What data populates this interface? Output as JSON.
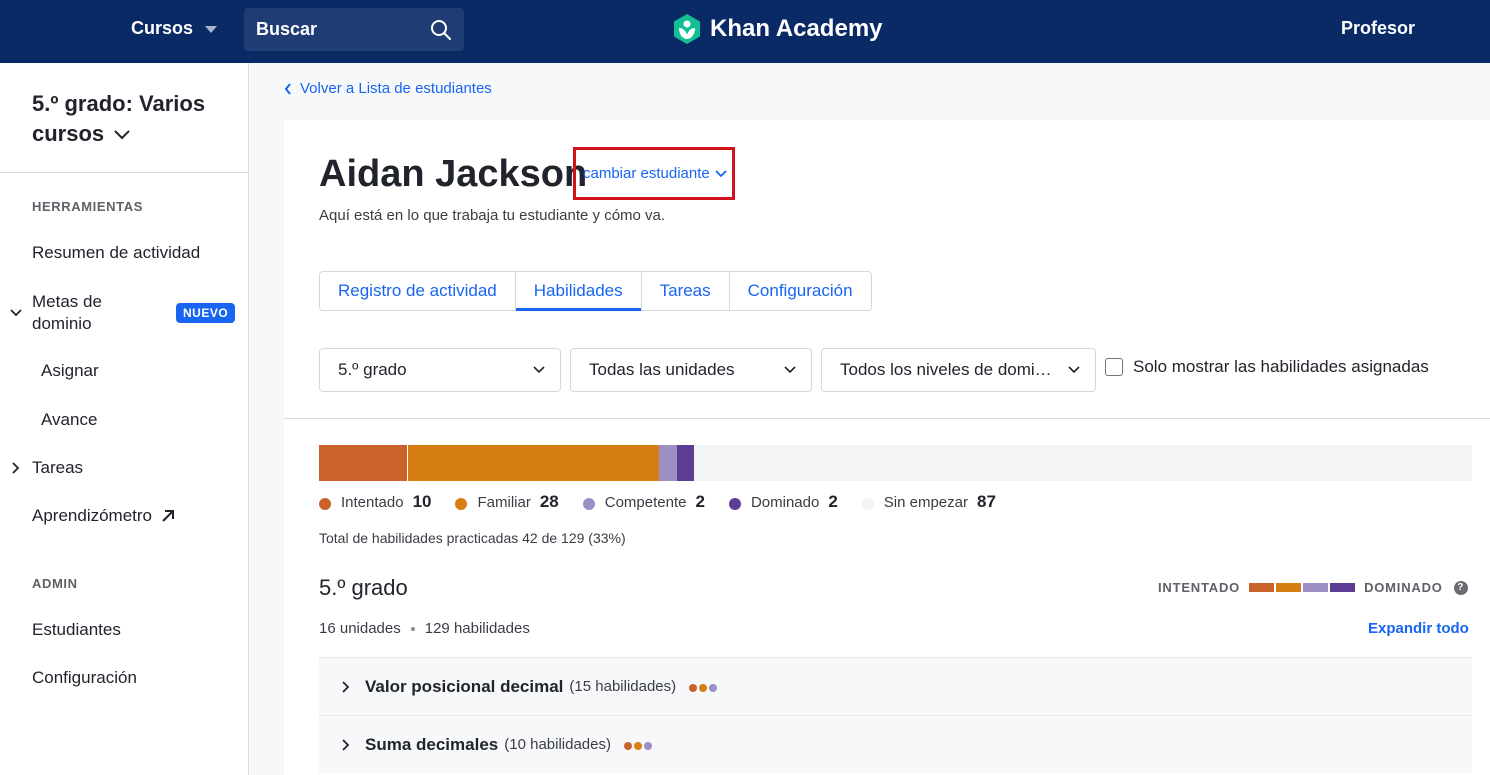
{
  "topbar": {
    "courses_label": "Cursos",
    "search_label": "Buscar",
    "brand": "Khan Academy",
    "role": "Profesor"
  },
  "sidebar": {
    "class_title": "5.º grado: Varios cursos",
    "tools_label": "HERRAMIENTAS",
    "items": {
      "activity": "Resumen de actividad",
      "mastery_goals": "Metas de dominio",
      "new_badge": "NUEVO",
      "assign": "Asignar",
      "progress": "Avance",
      "tasks": "Tareas",
      "learnometer": "Aprendizómetro"
    },
    "admin_label": "ADMIN",
    "admin_items": {
      "students": "Estudiantes",
      "settings": "Configuración"
    }
  },
  "back_link": "Volver a Lista de estudiantes",
  "student": {
    "name": "Aidan Jackson",
    "change_label": "cambiar estudiante",
    "subtitle": "Aquí está en lo que trabaja tu estudiante y cómo va."
  },
  "tabs": [
    {
      "label": "Registro de actividad",
      "active": false
    },
    {
      "label": "Habilidades",
      "active": true
    },
    {
      "label": "Tareas",
      "active": false
    },
    {
      "label": "Configuración",
      "active": false
    }
  ],
  "filters": {
    "grade": "5.º grado",
    "units": "Todas las unidades",
    "levels": "Todos los niveles de domi…",
    "only_assigned": "Solo mostrar las habilidades asignadas",
    "only_assigned_checked": false
  },
  "mastery": {
    "total_skills": 129,
    "levels": [
      {
        "label": "Intentado",
        "count": 10,
        "color": "#c9622b"
      },
      {
        "label": "Familiar",
        "count": 28,
        "color": "#d67d13"
      },
      {
        "label": "Competente",
        "count": 2,
        "color": "#9d8ec4"
      },
      {
        "label": "Dominado",
        "count": 2,
        "color": "#5e3d96"
      },
      {
        "label": "Sin empezar",
        "count": 87,
        "color": "#f3f4f6"
      }
    ],
    "total_text": "Total de habilidades practicadas 42 de 129 (33%)"
  },
  "grade_section": {
    "title": "5.º grado",
    "units_text": "16 unidades",
    "skills_text": "129 habilidades",
    "scale_low": "INTENTADO",
    "scale_high": "DOMINADO",
    "expand_all": "Expandir todo",
    "units": [
      {
        "name": "Valor posicional decimal",
        "count": "(15 habilidades)",
        "dots": [
          "#c9622b",
          "#d67d13",
          "#9d8ec4"
        ]
      },
      {
        "name": "Suma decimales",
        "count": "(10 habilidades)",
        "dots": [
          "#c9622b",
          "#d67d13",
          "#9d8ec4"
        ]
      }
    ]
  }
}
